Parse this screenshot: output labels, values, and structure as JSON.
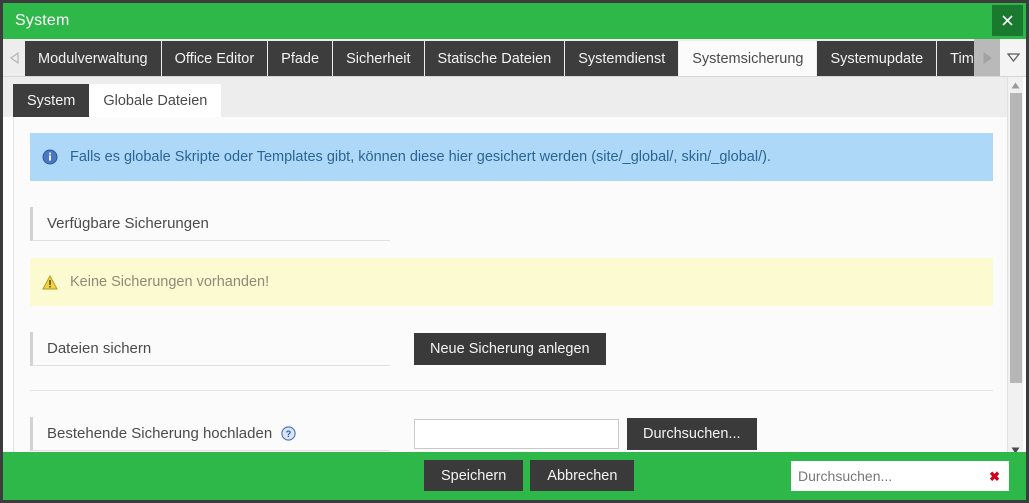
{
  "window": {
    "title": "System",
    "close_icon": "close-icon",
    "accent_green": "#2eb84a",
    "close_button_green": "#19792f",
    "dark_button": "#3a3a3a"
  },
  "main_tabs": {
    "scroll_left_icon": "chevron-left-icon",
    "scroll_right_icon": "chevron-right-icon",
    "dropdown_icon": "chevron-down-icon",
    "items": [
      {
        "label": "Modulverwaltung",
        "active": false
      },
      {
        "label": "Office Editor",
        "active": false
      },
      {
        "label": "Pfade",
        "active": false
      },
      {
        "label": "Sicherheit",
        "active": false
      },
      {
        "label": "Statische Dateien",
        "active": false
      },
      {
        "label": "Systemdienst",
        "active": false
      },
      {
        "label": "Systemsicherung",
        "active": true
      },
      {
        "label": "Systemupdate",
        "active": false
      },
      {
        "label": "Timeouts",
        "active": false
      }
    ]
  },
  "sub_tabs": {
    "items": [
      {
        "label": "System",
        "active": false
      },
      {
        "label": "Globale Dateien",
        "active": true
      }
    ]
  },
  "content": {
    "info_banner": {
      "icon": "info-icon",
      "text": "Falls es globale Skripte oder Templates gibt, können diese hier gesichert werden (site/_global/, skin/_global/).",
      "background": "#aed8f7",
      "text_color": "#2a6496"
    },
    "available_backups": {
      "label": "Verfügbare Sicherungen"
    },
    "warning_banner": {
      "icon": "warning-icon",
      "text": "Keine Sicherungen vorhanden!",
      "background": "#fcfad0",
      "text_color": "#8c8c7a"
    },
    "save_files": {
      "label": "Dateien sichern",
      "button_label": "Neue Sicherung anlegen"
    },
    "upload_backup": {
      "label": "Bestehende Sicherung hochladen",
      "help_icon": "help-circle-icon",
      "file_value": "",
      "file_placeholder": "",
      "browse_button_label": "Durchsuchen..."
    }
  },
  "scrollbar": {
    "up_icon": "triangle-up-icon",
    "down_icon": "triangle-down-icon"
  },
  "footer": {
    "save_label": "Speichern",
    "cancel_label": "Abbrechen",
    "search_value": "",
    "search_placeholder": "Durchsuchen...",
    "clear_icon": "clear-x-icon",
    "clear_glyph": "✖"
  }
}
